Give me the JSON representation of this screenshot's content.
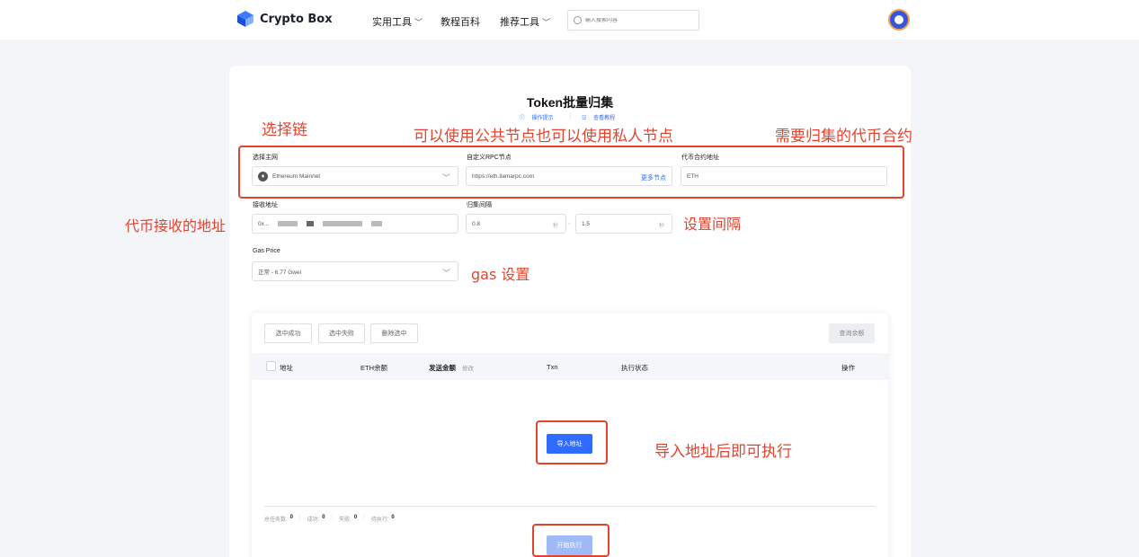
{
  "header": {
    "brand": "Crypto Box",
    "nav": [
      {
        "label": "实用工具",
        "has_dropdown": true
      },
      {
        "label": "教程百科",
        "has_dropdown": false
      },
      {
        "label": "推荐工具",
        "has_dropdown": true
      }
    ],
    "search_placeholder": "输入搜索内容"
  },
  "page": {
    "title": "Token批量归集",
    "links": {
      "tips": "操作提示",
      "tutorial": "查看教程"
    }
  },
  "form": {
    "network_label": "选择主网",
    "network_value": "Ethereum Mainnet",
    "rpc_label": "自定义RPC节点",
    "rpc_value": "https://eth.llamarpc.com",
    "rpc_more": "更多节点",
    "contract_label": "代币合约地址",
    "contract_value": "ETH",
    "receive_label": "接收地址",
    "receive_value_prefix": "0x...",
    "interval_label": "归集间隔",
    "interval_min": "0.8",
    "interval_max": "1.5",
    "interval_unit": "秒",
    "interval_sep": "-",
    "gas_label": "Gas Price",
    "gas_value": "正常 - 6.77 Gwei"
  },
  "annotations": {
    "chain": "选择链",
    "rpc": "可以使用公共节点也可以使用私人节点",
    "contract": "需要归集的代币合约",
    "receive": "代币接收的地址",
    "interval": "设置间隔",
    "gas": "gas 设置",
    "import": "导入地址后即可执行"
  },
  "table": {
    "toolbar": {
      "select_success": "选中成功",
      "select_failed": "选中失败",
      "delete_selected": "删除选中",
      "query_balance": "查询余额"
    },
    "columns": {
      "address": "地址",
      "eth_balance": "ETH余额",
      "amount": "发送金额",
      "amount_edit": "修改",
      "txn": "Txn",
      "status": "执行状态",
      "action": "操作"
    },
    "import_button": "导入地址",
    "stats": {
      "total_label": "总任务数:",
      "total": "0",
      "success_label": "成功:",
      "success": "0",
      "failed_label": "失败:",
      "failed": "0",
      "pending_label": "待执行:",
      "pending": "0"
    },
    "start_button": "开始执行"
  },
  "colors": {
    "accent": "#2f6bff",
    "annotation": "#e2442f"
  }
}
